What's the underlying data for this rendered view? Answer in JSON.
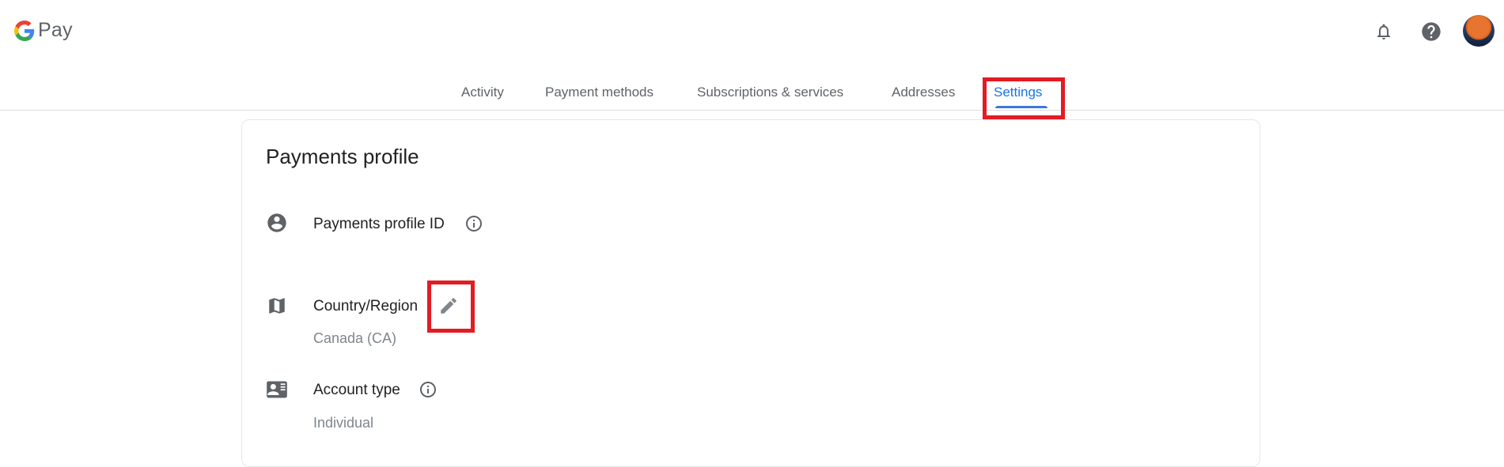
{
  "header": {
    "logo_text": "Pay",
    "icons": [
      "notifications-bell-icon",
      "help-icon",
      "account-avatar"
    ]
  },
  "tabs": [
    {
      "label": "Activity",
      "active": false
    },
    {
      "label": "Payment methods",
      "active": false
    },
    {
      "label": "Subscriptions & services",
      "active": false
    },
    {
      "label": "Addresses",
      "active": false
    },
    {
      "label": "Settings",
      "active": true
    }
  ],
  "colors": {
    "accent": "#1a73e8",
    "highlight_box": "#e31b23",
    "icon_gray": "#5f6368",
    "secondary_text": "#80868b"
  },
  "card": {
    "title": "Payments profile",
    "rows": [
      {
        "icon": "account-circle-icon",
        "label": "Payments profile ID",
        "has_info": true,
        "value": ""
      },
      {
        "icon": "map-icon",
        "label": "Country/Region",
        "has_edit": true,
        "value": "Canada (CA)"
      },
      {
        "icon": "contact-card-icon",
        "label": "Account type",
        "has_info": true,
        "value": "Individual"
      }
    ]
  }
}
